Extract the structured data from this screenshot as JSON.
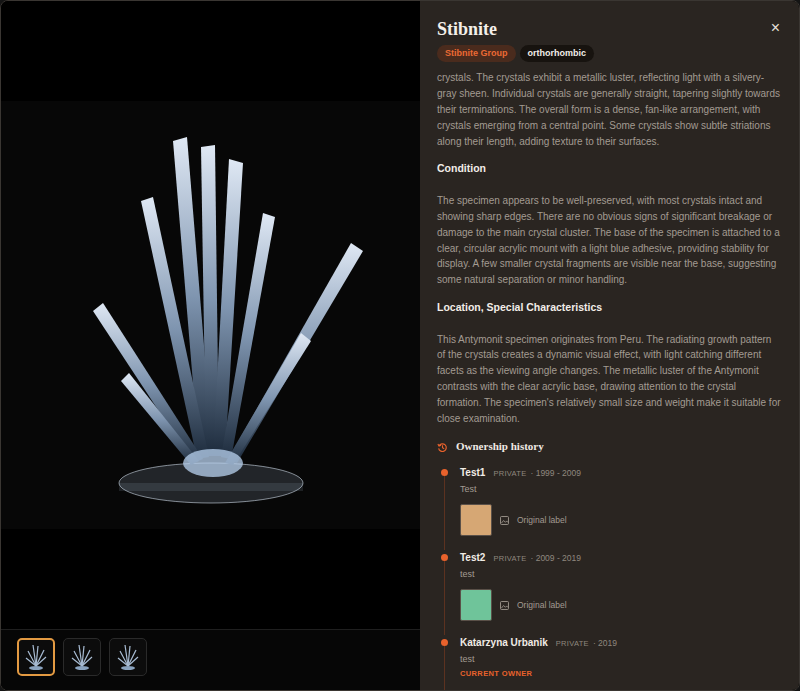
{
  "title": "Stibnite",
  "close": "×",
  "tags": [
    {
      "label": "Stibnite Group",
      "kind": "group"
    },
    {
      "label": "orthorhombic",
      "kind": "system"
    }
  ],
  "thumbnails": [
    {
      "selected": true
    },
    {
      "selected": false
    },
    {
      "selected": false
    }
  ],
  "description": "crystals. The crystals exhibit a metallic luster, reflecting light with a silvery-gray sheen. Individual crystals are generally straight, tapering slightly towards their terminations. The overall form is a dense, fan-like arrangement, with crystals emerging from a central point. Some crystals show subtle striations along their length, adding texture to their surfaces.",
  "sections": [
    {
      "heading": "Condition",
      "text": "The specimen appears to be well-preserved, with most crystals intact and showing sharp edges. There are no obvious signs of significant breakage or damage to the main crystal cluster. The base of the specimen is attached to a clear, circular acrylic mount with a light blue adhesive, providing stability for display. A few smaller crystal fragments are visible near the base, suggesting some natural separation or minor handling."
    },
    {
      "heading": "Location, Special Characteristics",
      "text": "This Antymonit specimen originates from Peru. The radiating growth pattern of the crystals creates a dynamic visual effect, with light catching different facets as the viewing angle changes. The metallic luster of the Antymonit contrasts with the clear acrylic base, drawing attention to the crystal formation. The specimen's relatively small size and weight make it suitable for close examination."
    }
  ],
  "ownership": {
    "title": "Ownership history",
    "owners": [
      {
        "name": "Test1",
        "visibility": "PRIVATE",
        "period": "· 1999 - 2009",
        "note": "Test",
        "current": false,
        "label": {
          "text": "Original label",
          "color": "#d6a774"
        }
      },
      {
        "name": "Test2",
        "visibility": "PRIVATE",
        "period": "· 2009 - 2019",
        "note": "test",
        "current": false,
        "label": {
          "text": "Original label",
          "color": "#6fc49a"
        }
      },
      {
        "name": "Katarzyna Urbanik",
        "visibility": "PRIVATE",
        "period": "· 2019",
        "note": "test",
        "current": true,
        "current_text": "CURRENT OWNER",
        "label": null
      }
    ]
  }
}
